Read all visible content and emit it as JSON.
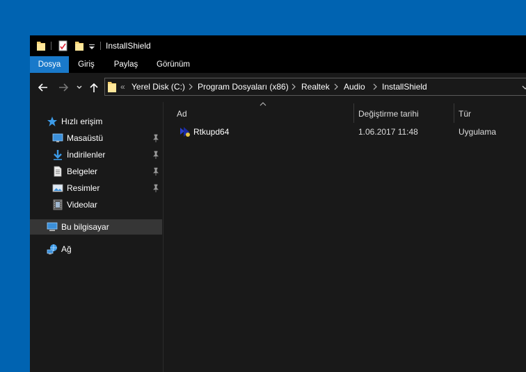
{
  "window": {
    "title": "InstallShield"
  },
  "ribbon": {
    "tabs": [
      {
        "label": "Dosya",
        "active": true
      },
      {
        "label": "Giriş",
        "active": false
      },
      {
        "label": "Paylaş",
        "active": false
      },
      {
        "label": "Görünüm",
        "active": false
      }
    ]
  },
  "address": {
    "overflow": "«",
    "crumbs": [
      "Yerel Disk (C:)",
      "Program Dosyaları (x86)",
      "Realtek",
      "Audio",
      "InstallShield"
    ]
  },
  "nav": {
    "quick_access": "Hızlı erişim",
    "items": [
      {
        "label": "Masaüstü",
        "icon": "desktop-icon",
        "pinned": true
      },
      {
        "label": "İndirilenler",
        "icon": "downloads-icon",
        "pinned": true
      },
      {
        "label": "Belgeler",
        "icon": "documents-icon",
        "pinned": true
      },
      {
        "label": "Resimler",
        "icon": "pictures-icon",
        "pinned": true
      },
      {
        "label": "Videolar",
        "icon": "videos-icon",
        "pinned": false
      }
    ],
    "this_pc": "Bu bilgisayar",
    "network": "Ağ"
  },
  "columns": {
    "name": "Ad",
    "date": "Değiştirme tarihi",
    "type": "Tür"
  },
  "files": [
    {
      "name": "Rtkupd64",
      "date": "1.06.2017 11:48",
      "type": "Uygulama"
    }
  ],
  "colors": {
    "desktop": "#0063b1",
    "accent": "#1979ca",
    "window_bg": "#191919",
    "titlebar_bg": "#000000",
    "selected_bg": "#363636"
  }
}
